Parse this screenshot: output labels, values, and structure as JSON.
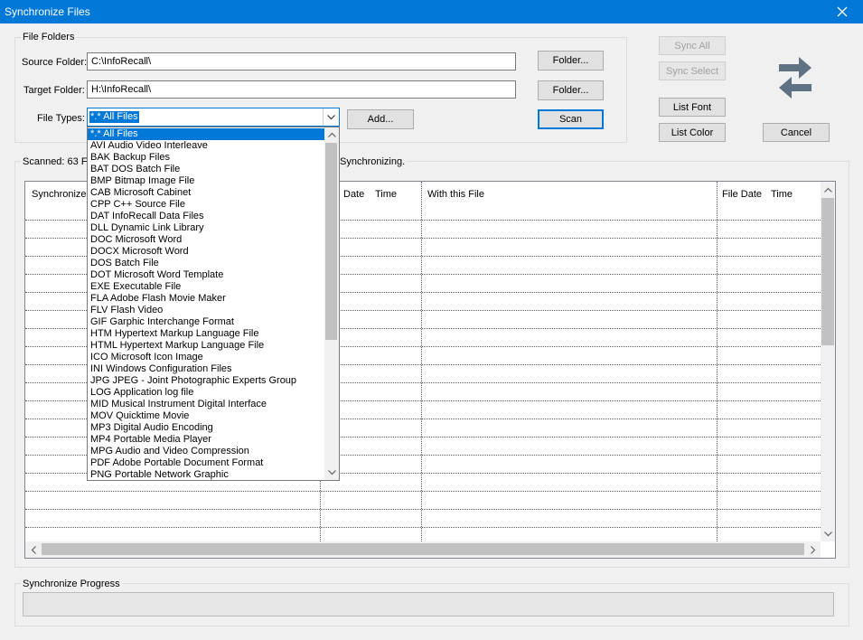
{
  "window": {
    "title": "Synchronize Files"
  },
  "file_folders": {
    "group_label": "File Folders",
    "source_label": "Source Folder:",
    "source_value": "C:\\InfoRecall\\",
    "target_label": "Target Folder:",
    "target_value": "H:\\InfoRecall\\",
    "filetypes_label": "File Types:",
    "filetypes_value": "*.* All Files",
    "folder_button": "Folder...",
    "add_button": "Add...",
    "scan_button": "Scan"
  },
  "right_buttons": {
    "sync_all": "Sync All",
    "sync_select": "Sync Select",
    "list_font": "List Font",
    "list_color": "List Color",
    "cancel": "Cancel"
  },
  "status": {
    "scanned_prefix": "Scanned: 63 Fi",
    "synchronizing": "Synchronizing."
  },
  "grid": {
    "columns": {
      "synchronize": "Synchronize t",
      "date": "Date",
      "time": "Time",
      "with_file": "With this File",
      "file_date": "File Date",
      "file_time": "Time"
    }
  },
  "file_types": [
    "*.* All Files",
    "AVI Audio Video Interleave",
    "BAK Backup Files",
    "BAT DOS Batch File",
    "BMP Bitmap Image File",
    "CAB Microsoft Cabinet",
    "CPP C++ Source File",
    "DAT InfoRecall Data Files",
    "DLL Dynamic Link Library",
    "DOC Microsoft Word",
    "DOCX Microsoft Word",
    "DOS Batch File",
    "DOT Microsoft Word Template",
    "EXE Executable File",
    "FLA Adobe Flash Movie Maker",
    "FLV Flash Video",
    "GIF Garphic Interchange Format",
    "HTM Hypertext Markup Language File",
    "HTML Hypertext Markup Language File",
    "ICO Microsoft Icon Image",
    "INI Windows Configuration Files",
    "JPG JPEG - Joint Photographic Experts Group",
    "LOG Application log file",
    "MID Musical Instrument Digital Interface",
    "MOV Quicktime Movie",
    "MP3 Digital Audio Encoding",
    "MP4 Portable Media Player",
    "MPG Audio and Video Compression",
    "PDF Adobe Portable Document Format",
    "PNG Portable Network Graphic"
  ],
  "progress": {
    "label": "Synchronize Progress",
    "value": 0
  },
  "icons": {
    "close": "close-icon",
    "swap": "swap-arrows-icon",
    "dropdown": "chevron-down-icon"
  },
  "colors": {
    "titlebar": "#0078d7",
    "selection": "#0078d7",
    "swap_arrows": "#5f7283"
  }
}
